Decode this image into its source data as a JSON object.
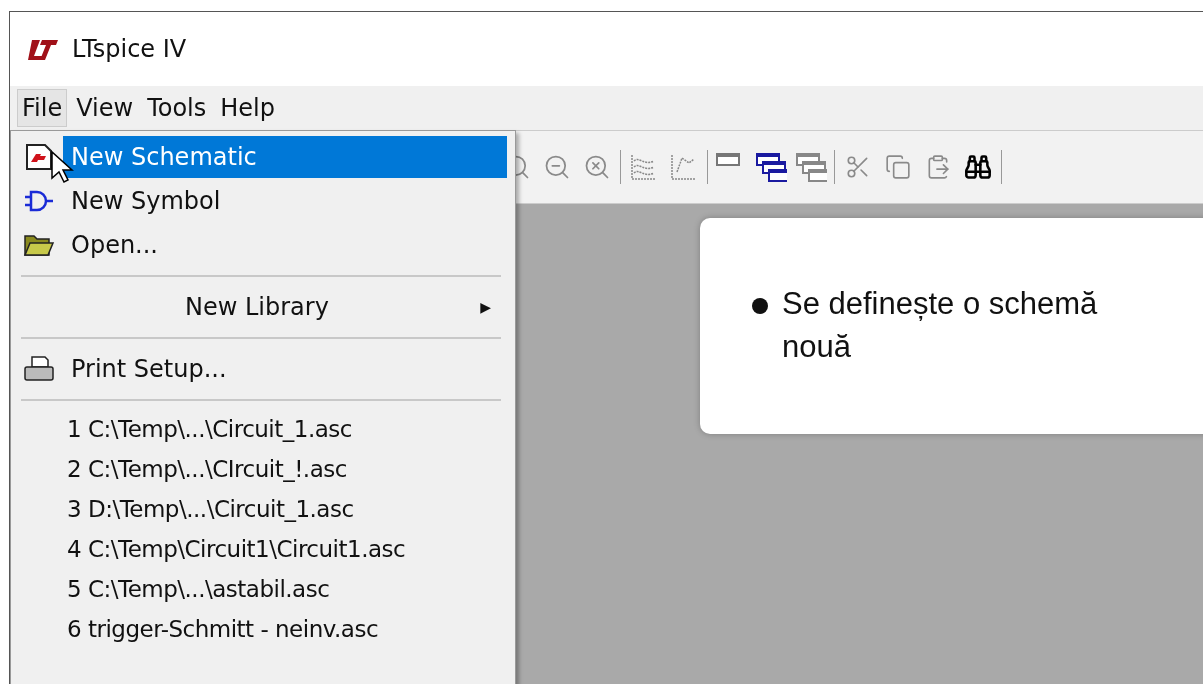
{
  "window": {
    "title": "LTspice IV"
  },
  "menu_bar": [
    {
      "label": "File",
      "selected": true
    },
    {
      "label": "View",
      "selected": false
    },
    {
      "label": "Tools",
      "selected": false
    },
    {
      "label": "Help",
      "selected": false
    }
  ],
  "file_menu": [
    {
      "kind": "schematic",
      "label": "New Schematic",
      "selected": true
    },
    {
      "kind": "symbol",
      "label": "New Symbol",
      "selected": false
    },
    {
      "kind": "folder",
      "label": "Open...",
      "selected": false
    },
    {
      "kind": "separator"
    },
    {
      "kind": "submenu",
      "label": "New Library",
      "arrow": "▶",
      "selected": false
    },
    {
      "kind": "separator"
    },
    {
      "kind": "printer",
      "label": "Print Setup...",
      "selected": false
    },
    {
      "kind": "separator"
    },
    {
      "kind": "recent",
      "label": "1 C:\\Temp\\...\\Circuit_1.asc",
      "selected": false
    },
    {
      "kind": "recent",
      "label": "2 C:\\Temp\\...\\CIrcuit_!.asc",
      "selected": false
    },
    {
      "kind": "recent",
      "label": "3 D:\\Temp\\...\\Circuit_1.asc",
      "selected": false
    },
    {
      "kind": "recent",
      "label": "4 C:\\Temp\\Circuit1\\Circuit1.asc",
      "selected": false
    },
    {
      "kind": "recent",
      "label": "5 C:\\Temp\\...\\astabil.asc",
      "selected": false
    },
    {
      "kind": "recent",
      "label": "6 trigger-Schmitt - neinv.asc",
      "selected": false
    }
  ],
  "note": {
    "bullets": [
      "Se definește o schemă nouă"
    ]
  }
}
